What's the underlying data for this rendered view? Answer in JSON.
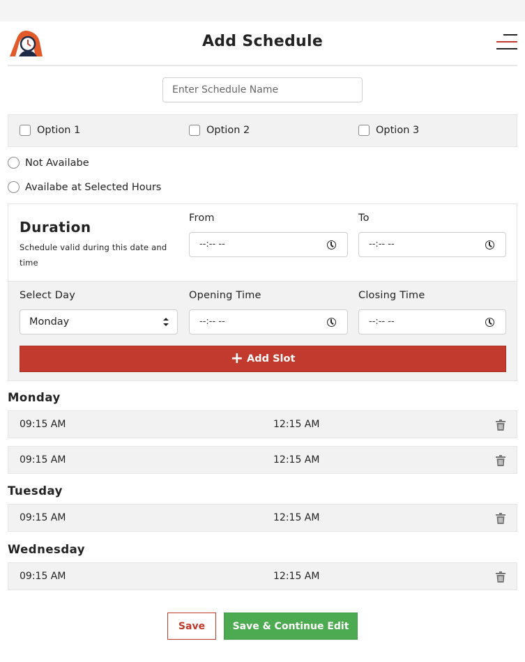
{
  "header": {
    "title": "Add Schedule",
    "logo_icon": "clock-logo-icon",
    "menu_icon": "hamburger-menu-icon"
  },
  "schedule_name": {
    "placeholder": "Enter Schedule Name",
    "value": ""
  },
  "options": [
    {
      "label": "Option 1",
      "checked": false
    },
    {
      "label": "Option 2",
      "checked": false
    },
    {
      "label": "Option 3",
      "checked": false
    }
  ],
  "availability": [
    {
      "label": "Not Availabe",
      "selected": false
    },
    {
      "label": "Availabe at Selected Hours",
      "selected": false
    }
  ],
  "duration": {
    "title": "Duration",
    "subtitle": "Schedule valid during this date and time",
    "from_label": "From",
    "to_label": "To",
    "from_value": "--:-- --",
    "to_value": "--:-- --"
  },
  "slot_form": {
    "day_label": "Select Day",
    "day_value": "Monday",
    "opening_label": "Opening Time",
    "opening_value": "--:-- --",
    "closing_label": "Closing Time",
    "closing_value": "--:-- --",
    "add_label": "Add Slot"
  },
  "days": [
    {
      "name": "Monday",
      "slots": [
        {
          "start": "09:15 AM",
          "end": "12:15 AM"
        },
        {
          "start": "09:15 AM",
          "end": "12:15 AM"
        }
      ]
    },
    {
      "name": "Tuesday",
      "slots": [
        {
          "start": "09:15 AM",
          "end": "12:15 AM"
        }
      ]
    },
    {
      "name": "Wednesday",
      "slots": [
        {
          "start": "09:15 AM",
          "end": "12:15 AM"
        }
      ]
    }
  ],
  "footer": {
    "save_label": "Save",
    "save_continue_label": "Save & Continue Edit"
  },
  "colors": {
    "accent_red": "#c13a2d",
    "success_green": "#4caa50",
    "panel_gray": "#f2f2f2"
  }
}
